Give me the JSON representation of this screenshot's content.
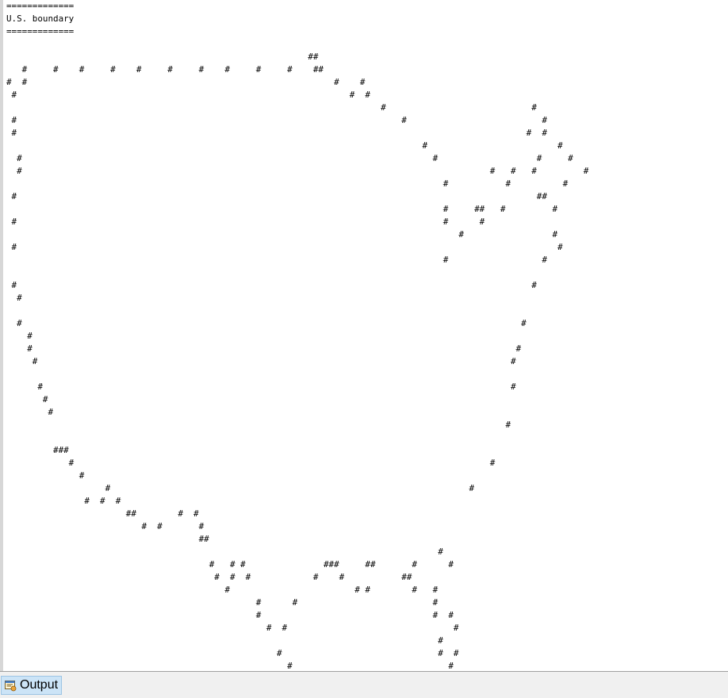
{
  "console": {
    "lines": [
      "=============",
      "U.S. boundary",
      "=============",
      "",
      "                                                          ##",
      "   #     #    #     #    #     #     #    #     #     #    ##",
      "#  #                                                           #    #",
      " #                                                                #  #",
      "                                                                        #                            #",
      " #                                                                          #                          #",
      " #                                                                                                  #  #",
      "                                                                                #                         #",
      "  #                                                                               #                   #     #",
      "  #                                                                                          #   #   #         #",
      "                                                                                    #           #          #",
      " #                                                                                                    ##",
      "                                                                                    #     ##   #         #",
      " #                                                                                  #      #",
      "                                                                                       #                 #",
      " #                                                                                                        #",
      "                                                                                    #                  #",
      "",
      " #                                                                                                   #",
      "  #",
      "",
      "  #                                                                                                #",
      "    #",
      "    #                                                                                             #",
      "     #                                                                                           #",
      "",
      "      #                                                                                          #",
      "       #",
      "        #",
      "                                                                                                #",
      "",
      "         ###",
      "            #                                                                                #",
      "              #",
      "                   #                                                                     #",
      "               #  #  #",
      "                       ##        #  #",
      "                          #  #       #",
      "                                     ##",
      "                                                                                   #",
      "                                       #   # #               ###     ##       #      #",
      "                                        #  #  #            #    #           ##",
      "                                          #                        # #        #   #",
      "                                                #      #                          #",
      "                                                #                                 #  #",
      "                                                  #  #                                #",
      "                                                                                   #",
      "                                                    #                              #  #",
      "                                                      #                              #"
    ]
  },
  "bottom_panel": {
    "tab_label": "Output",
    "tab_icon": "output-window-icon"
  }
}
